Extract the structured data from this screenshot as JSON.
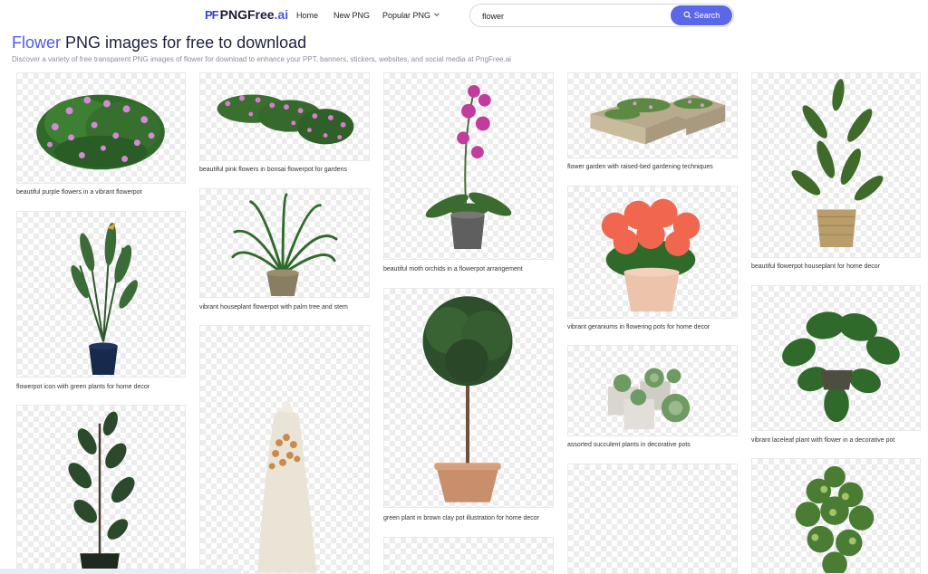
{
  "header": {
    "logo_mark": "PF",
    "logo_text": "PNGFree",
    "logo_suffix": ".ai",
    "nav": [
      {
        "label": "Home"
      },
      {
        "label": "New PNG"
      },
      {
        "label": "Popular PNG"
      }
    ],
    "search": {
      "value": "flower",
      "button_label": "Search"
    }
  },
  "page": {
    "title_keyword": "Flower",
    "title_rest": "PNG images for free to download",
    "subtitle": "Discover a variety of free transparent PNG images of flower for download to enhance your PPT, banners, stickers, websites, and social media at PngFree.ai"
  },
  "cards": [
    {
      "caption": "beautiful purple flowers in a vibrant flowerpot",
      "subject": "purple-flower-bush"
    },
    {
      "caption": "flowerpot icon with green plants for home decor",
      "subject": "bird-of-paradise-pot"
    },
    {
      "caption": "",
      "subject": "rubber-plant-pot"
    },
    {
      "caption": "beautiful pink flowers in bonsai flowerpot for gardens",
      "subject": "pink-flower-hedge"
    },
    {
      "caption": "vibrant houseplant flowerpot with palm tree and stem",
      "subject": "palm-houseplant"
    },
    {
      "caption": "",
      "subject": "dried-flower-bouquet"
    },
    {
      "caption": "beautiful moth orchids in a flowerpot arrangement",
      "subject": "moth-orchid"
    },
    {
      "caption": "green plant in brown clay pot illustration for home decor",
      "subject": "topiary-tree-pot"
    },
    {
      "caption": "",
      "subject": "blank"
    },
    {
      "caption": "flower garden with raised-bed gardening techniques",
      "subject": "raised-bed-garden"
    },
    {
      "caption": "vibrant geraniums in flowering pots for home decor",
      "subject": "red-geraniums"
    },
    {
      "caption": "assorted succulent plants in decorative pots",
      "subject": "succulent-pots"
    },
    {
      "caption": "",
      "subject": "blank"
    },
    {
      "caption": "beautiful flowerpot houseplant for home decor",
      "subject": "dracaena-basket"
    },
    {
      "caption": "vibrant laceleaf plant with flower in a decorative pot",
      "subject": "laceleaf-plant"
    },
    {
      "caption": "",
      "subject": "schefflera-plant"
    }
  ],
  "colors": {
    "accent": "#5a67e8",
    "title_keyword": "#4d5be6",
    "checker": "#ececec"
  }
}
